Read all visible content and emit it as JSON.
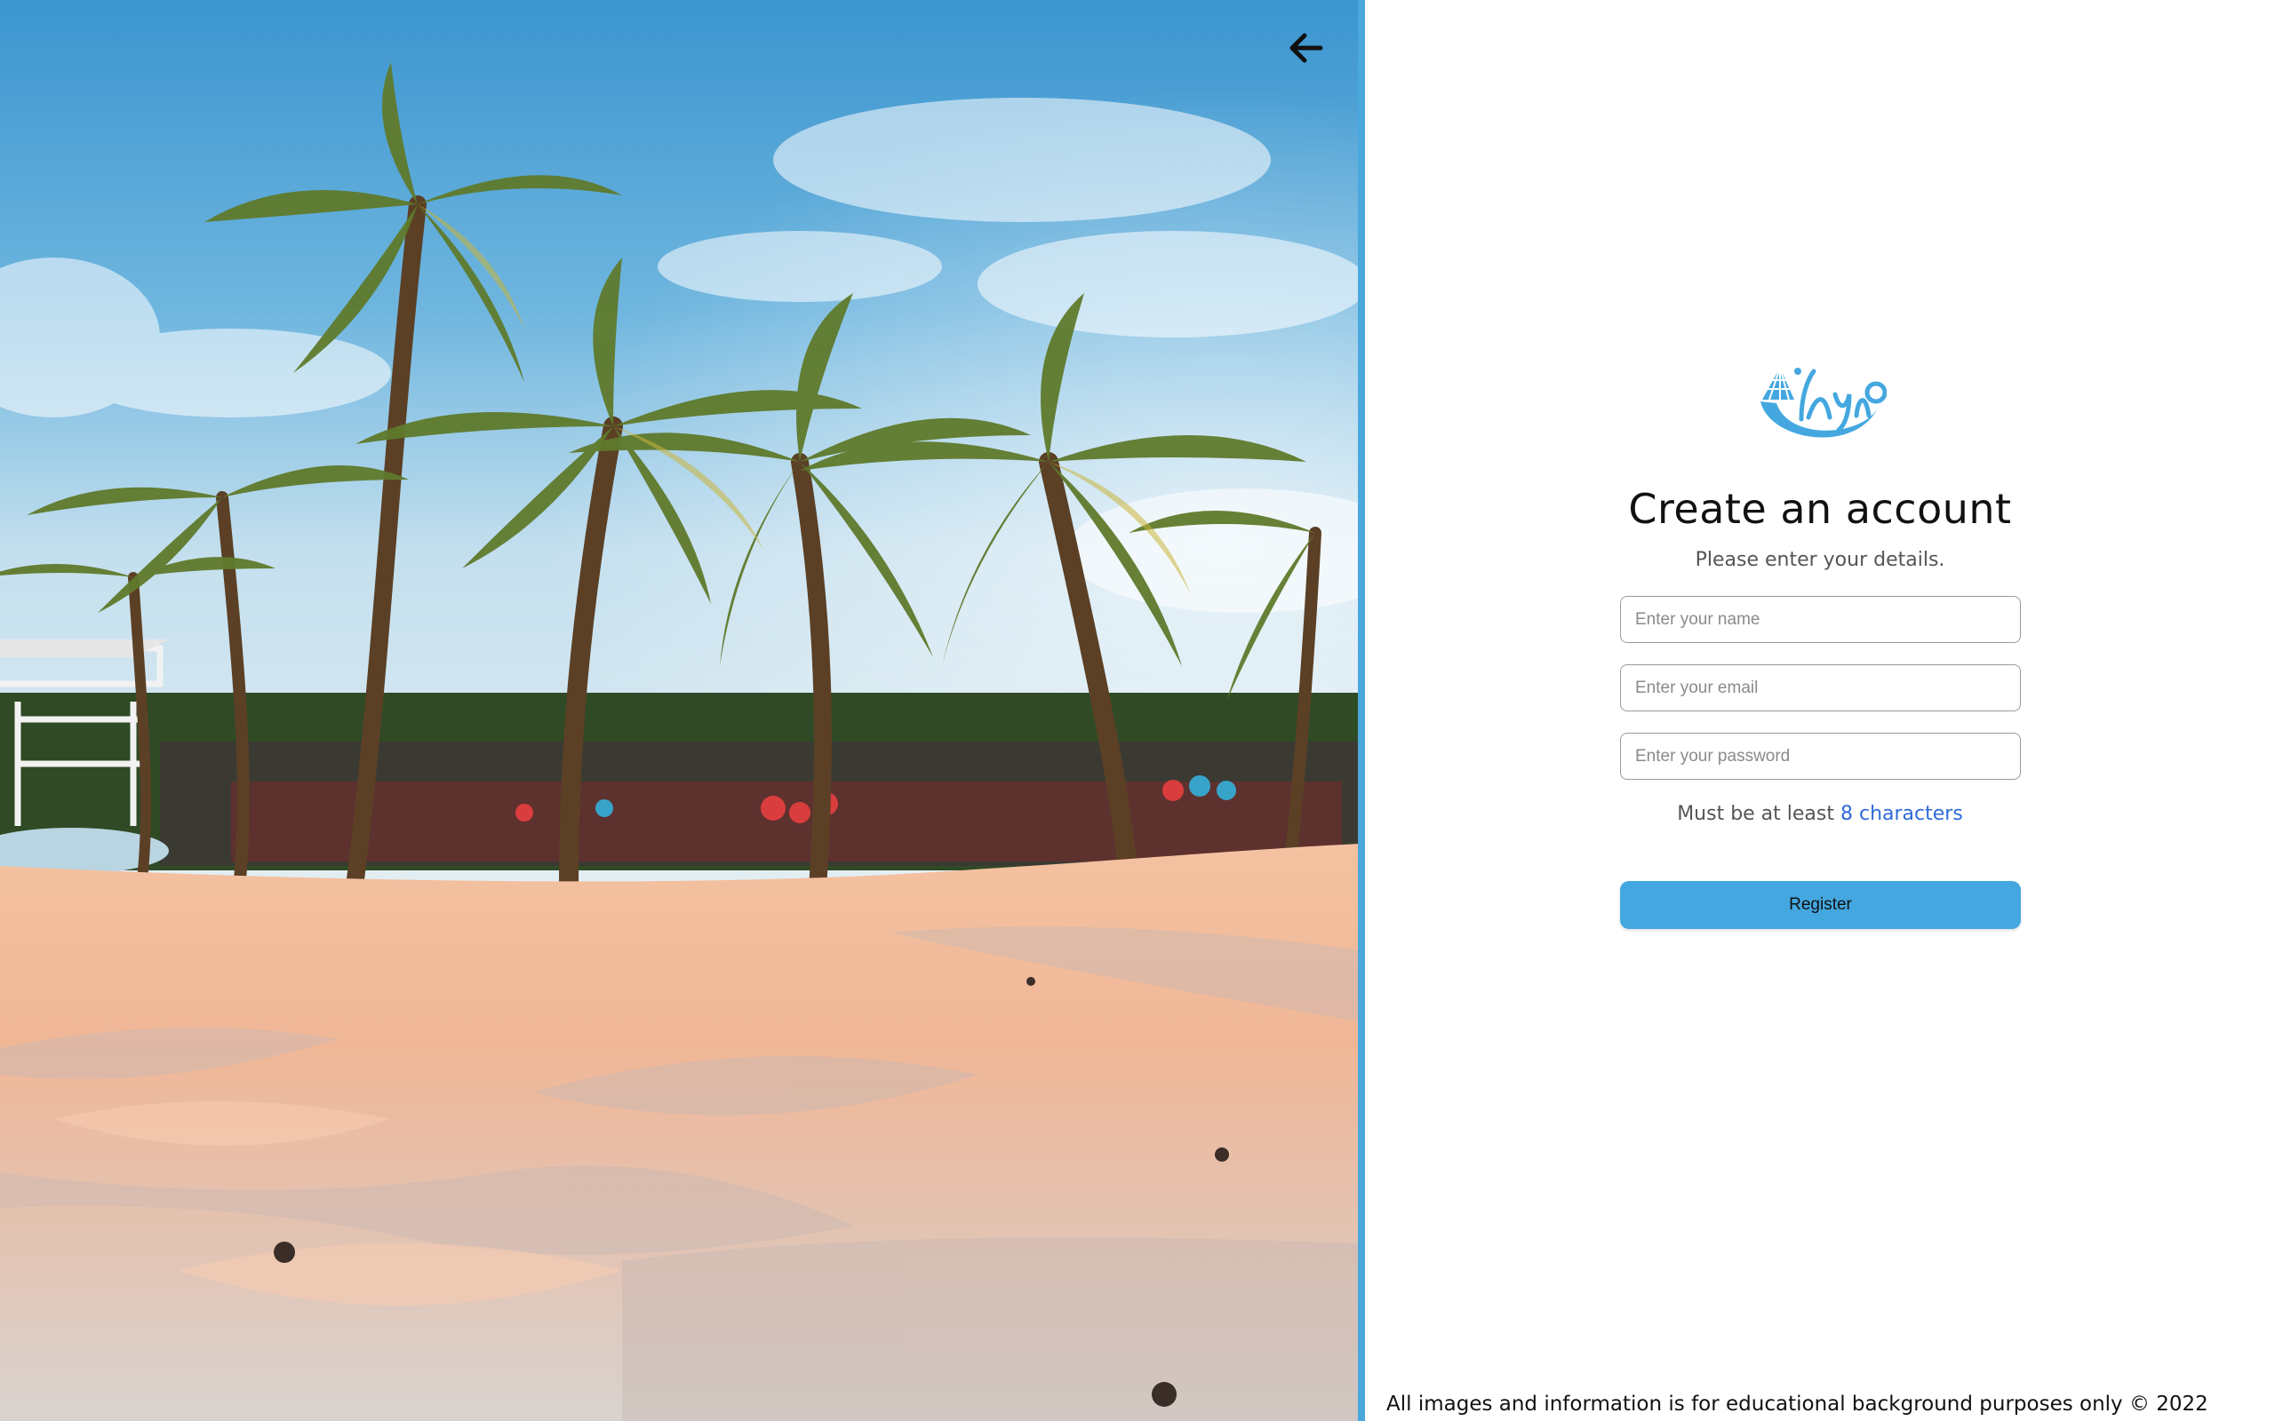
{
  "hero": {
    "image_alt": "Palm trees on a sandy beach"
  },
  "nav": {
    "back_icon": "arrow-left-icon"
  },
  "brand": {
    "logo_text": "IAYAO",
    "logo_icon": "boat-wave-logo"
  },
  "form": {
    "title": "Create an account",
    "subtitle": "Please enter your details.",
    "name_placeholder": "Enter your name",
    "email_placeholder": "Enter your email",
    "password_placeholder": "Enter your password",
    "hint_prefix": "Must be at least ",
    "hint_accent": "8 characters",
    "register_label": "Register"
  },
  "footer": {
    "text": "All images and information is for educational background purposes only © 2022"
  },
  "colors": {
    "accent": "#44a7e0",
    "divider": "#4aa8de",
    "link": "#2f6ad8"
  }
}
